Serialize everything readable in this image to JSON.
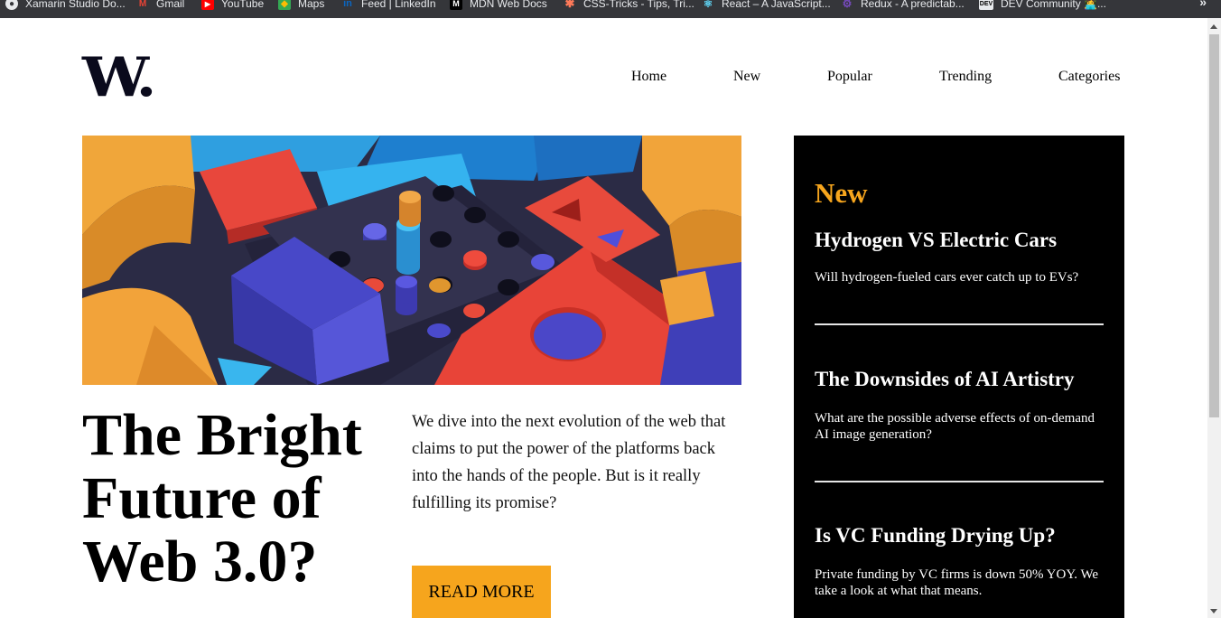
{
  "bookmarks": [
    {
      "label": "Xamarin Studio Do...",
      "icon": "xamarin-icon"
    },
    {
      "label": "Gmail",
      "icon": "gmail-icon"
    },
    {
      "label": "YouTube",
      "icon": "youtube-icon"
    },
    {
      "label": "Maps",
      "icon": "maps-icon"
    },
    {
      "label": "Feed | LinkedIn",
      "icon": "linkedin-icon"
    },
    {
      "label": "MDN Web Docs",
      "icon": "mdn-icon"
    },
    {
      "label": "CSS-Tricks - Tips, Tri...",
      "icon": "css-tricks-icon"
    },
    {
      "label": "React – A JavaScript...",
      "icon": "react-icon"
    },
    {
      "label": "Redux - A predictab...",
      "icon": "redux-icon"
    },
    {
      "label": "DEV Community 👩‍💻...",
      "icon": "dev-icon"
    }
  ],
  "bookmarks_more": "»",
  "logo": "W.",
  "nav": {
    "home": "Home",
    "new": "New",
    "popular": "Popular",
    "trending": "Trending",
    "categories": "Categories"
  },
  "article": {
    "headline": "The Bright Future of Web 3.0?",
    "summary": "We dive into the next evolution of the web that claims to put the power of the platforms back into the hands of the people. But is it really fulfilling its promise?",
    "cta": "READ MORE"
  },
  "sidebar": {
    "title": "New",
    "items": [
      {
        "title": "Hydrogen VS Electric Cars",
        "text": "Will hydrogen-fueled cars ever catch up to EVs?"
      },
      {
        "title": "The Downsides of AI Artistry",
        "text": "What are the possible adverse effects of on-demand AI image generation?"
      },
      {
        "title": "Is VC Funding Drying Up?",
        "text": "Private funding by VC firms is down 50% YOY. We take a look at what that means."
      }
    ]
  },
  "colors": {
    "accent": "#f6a51d",
    "sidebar_bg": "#000000",
    "text": "#000000",
    "logo": "#0a0a1c"
  }
}
